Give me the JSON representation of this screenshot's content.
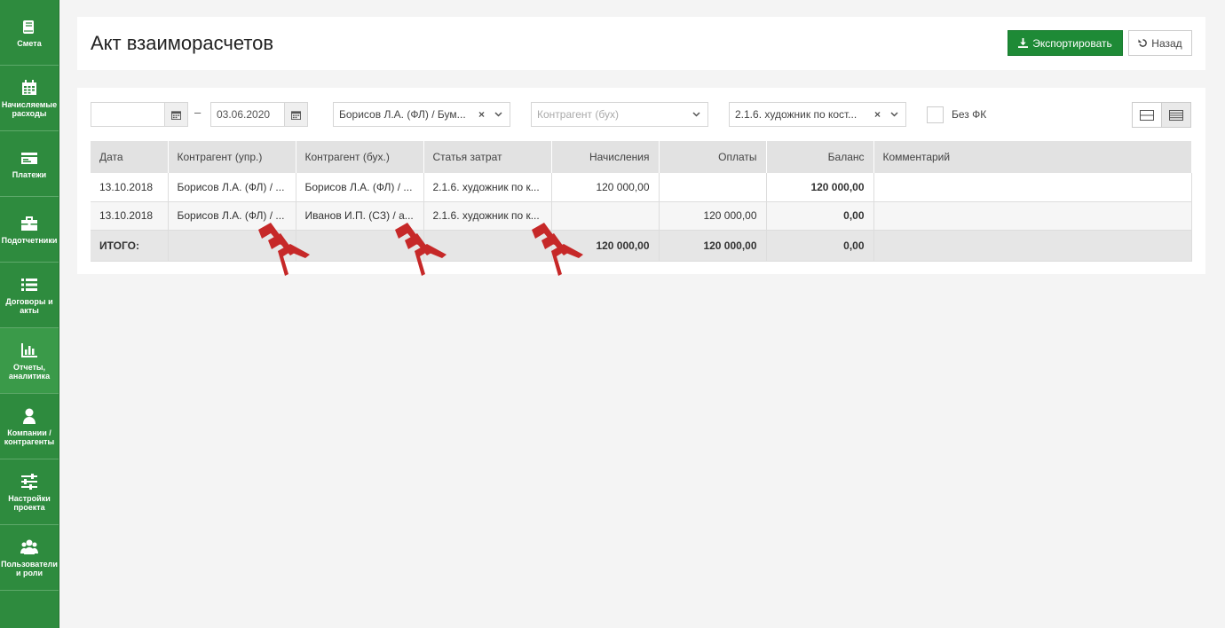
{
  "sidebar": {
    "items": [
      {
        "label": "Смета",
        "icon": "book-icon"
      },
      {
        "label": "Начисляемые расходы",
        "icon": "calendar-icon"
      },
      {
        "label": "Платежи",
        "icon": "credit-card-icon"
      },
      {
        "label": "Подотчетники",
        "icon": "briefcase-icon"
      },
      {
        "label": "Договоры и акты",
        "icon": "list-icon"
      },
      {
        "label": "Отчеты, аналитика",
        "icon": "bar-chart-icon"
      },
      {
        "label": "Компании / контрагенты",
        "icon": "user-icon"
      },
      {
        "label": "Настройки проекта",
        "icon": "sliders-icon"
      },
      {
        "label": "Пользователи и роли",
        "icon": "users-icon"
      }
    ]
  },
  "header": {
    "title": "Акт взаиморасчетов",
    "export_label": "Экспортировать",
    "back_label": "Назад"
  },
  "filters": {
    "date_from": "",
    "date_separator": "–",
    "date_to": "03.06.2020",
    "counterparty_upr": "Борисов Л.А. (ФЛ) / Бум...",
    "counterparty_buh_placeholder": "Контрагент (бух)",
    "cost_item": "2.1.6. художник по кост...",
    "without_fk_label": "Без ФК"
  },
  "table": {
    "headers": [
      "Дата",
      "Контрагент (упр.)",
      "Контрагент (бух.)",
      "Статья затрат",
      "Начисления",
      "Оплаты",
      "Баланс",
      "Комментарий"
    ],
    "rows": [
      [
        "13.10.2018",
        "Борисов Л.А. (ФЛ) / ...",
        "Борисов Л.А. (ФЛ) / ...",
        "2.1.6. художник по к...",
        "120 000,00",
        "",
        "120 000,00",
        ""
      ],
      [
        "13.10.2018",
        "Борисов Л.А. (ФЛ) / ...",
        "Иванов И.П. (СЗ) / а...",
        "2.1.6. художник по к...",
        "",
        "120 000,00",
        "0,00",
        ""
      ]
    ],
    "total": [
      "ИТОГО:",
      "",
      "",
      "",
      "120 000,00",
      "120 000,00",
      "0,00",
      ""
    ]
  },
  "colors": {
    "sidebar": "#2e8b3e",
    "primary_button": "#1e8a36",
    "marker": "#c62828"
  }
}
